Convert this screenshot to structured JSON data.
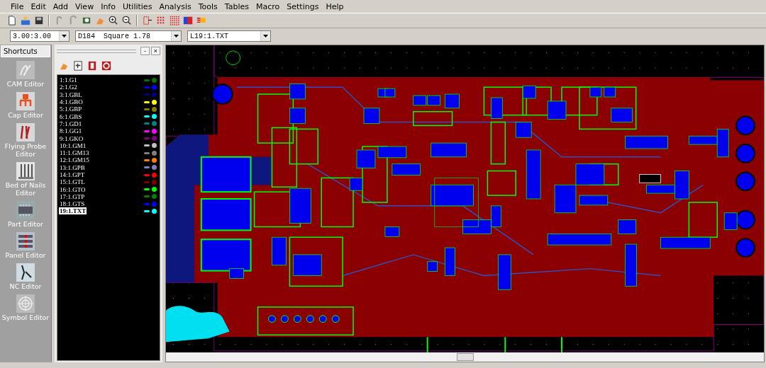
{
  "menu": [
    "File",
    "Edit",
    "Add",
    "View",
    "Info",
    "Utilities",
    "Analysis",
    "Tools",
    "Tables",
    "Macro",
    "Settings",
    "Help"
  ],
  "combos": [
    {
      "value": "3.00:3.00"
    },
    {
      "value": "D184  Square 1.78"
    },
    {
      "value": "L19:1.TXT"
    }
  ],
  "shortcuts": {
    "title": "Shortcuts",
    "items": [
      {
        "label": "CAM Editor",
        "kind": "cam"
      },
      {
        "label": "Cap Editor",
        "kind": "cap"
      },
      {
        "label": "Flying Probe Editor",
        "kind": "probe"
      },
      {
        "label": "Bed of Nails Editor",
        "kind": "nails"
      },
      {
        "label": "Part Editor",
        "kind": "part"
      },
      {
        "label": "Panel Editor",
        "kind": "panel"
      },
      {
        "label": "NC Editor",
        "kind": "nc"
      },
      {
        "label": "Symbol Editor",
        "kind": "symbol"
      }
    ]
  },
  "layers": {
    "window_buttons": [
      "-",
      "×"
    ],
    "items": [
      {
        "label": "1:1.G1",
        "color": "#007700",
        "selected": false
      },
      {
        "label": "2:1.G2",
        "color": "#0000ff",
        "selected": false
      },
      {
        "label": "3:1.GBL",
        "color": "#000080",
        "selected": false
      },
      {
        "label": "4:1.GBO",
        "color": "#ffff00",
        "selected": false
      },
      {
        "label": "5:1.GBP",
        "color": "#808000",
        "selected": false
      },
      {
        "label": "6:1.GBS",
        "color": "#00ffff",
        "selected": false
      },
      {
        "label": "7:1.GD1",
        "color": "#008080",
        "selected": false
      },
      {
        "label": "8:1.GG1",
        "color": "#ff00ff",
        "selected": false
      },
      {
        "label": "9:1.GKO",
        "color": "#800080",
        "selected": false
      },
      {
        "label": "10:1.GM1",
        "color": "#c0c0c0",
        "selected": false
      },
      {
        "label": "11:1.GM13",
        "color": "#808080",
        "selected": false
      },
      {
        "label": "12:1.GM15",
        "color": "#ff8000",
        "selected": false
      },
      {
        "label": "13:1.GPB",
        "color": "#8080c0",
        "selected": false
      },
      {
        "label": "14:1.GPT",
        "color": "#ff0000",
        "selected": false
      },
      {
        "label": "15:1.GTL",
        "color": "#800000",
        "selected": false
      },
      {
        "label": "16:1.GTO",
        "color": "#00ff00",
        "selected": false
      },
      {
        "label": "17:1.GTP",
        "color": "#008000",
        "selected": false
      },
      {
        "label": "18:1.GTS",
        "color": "#0000ff",
        "selected": false
      },
      {
        "label": "19:1.TXT",
        "color": "#00ffff",
        "selected": true
      }
    ]
  }
}
